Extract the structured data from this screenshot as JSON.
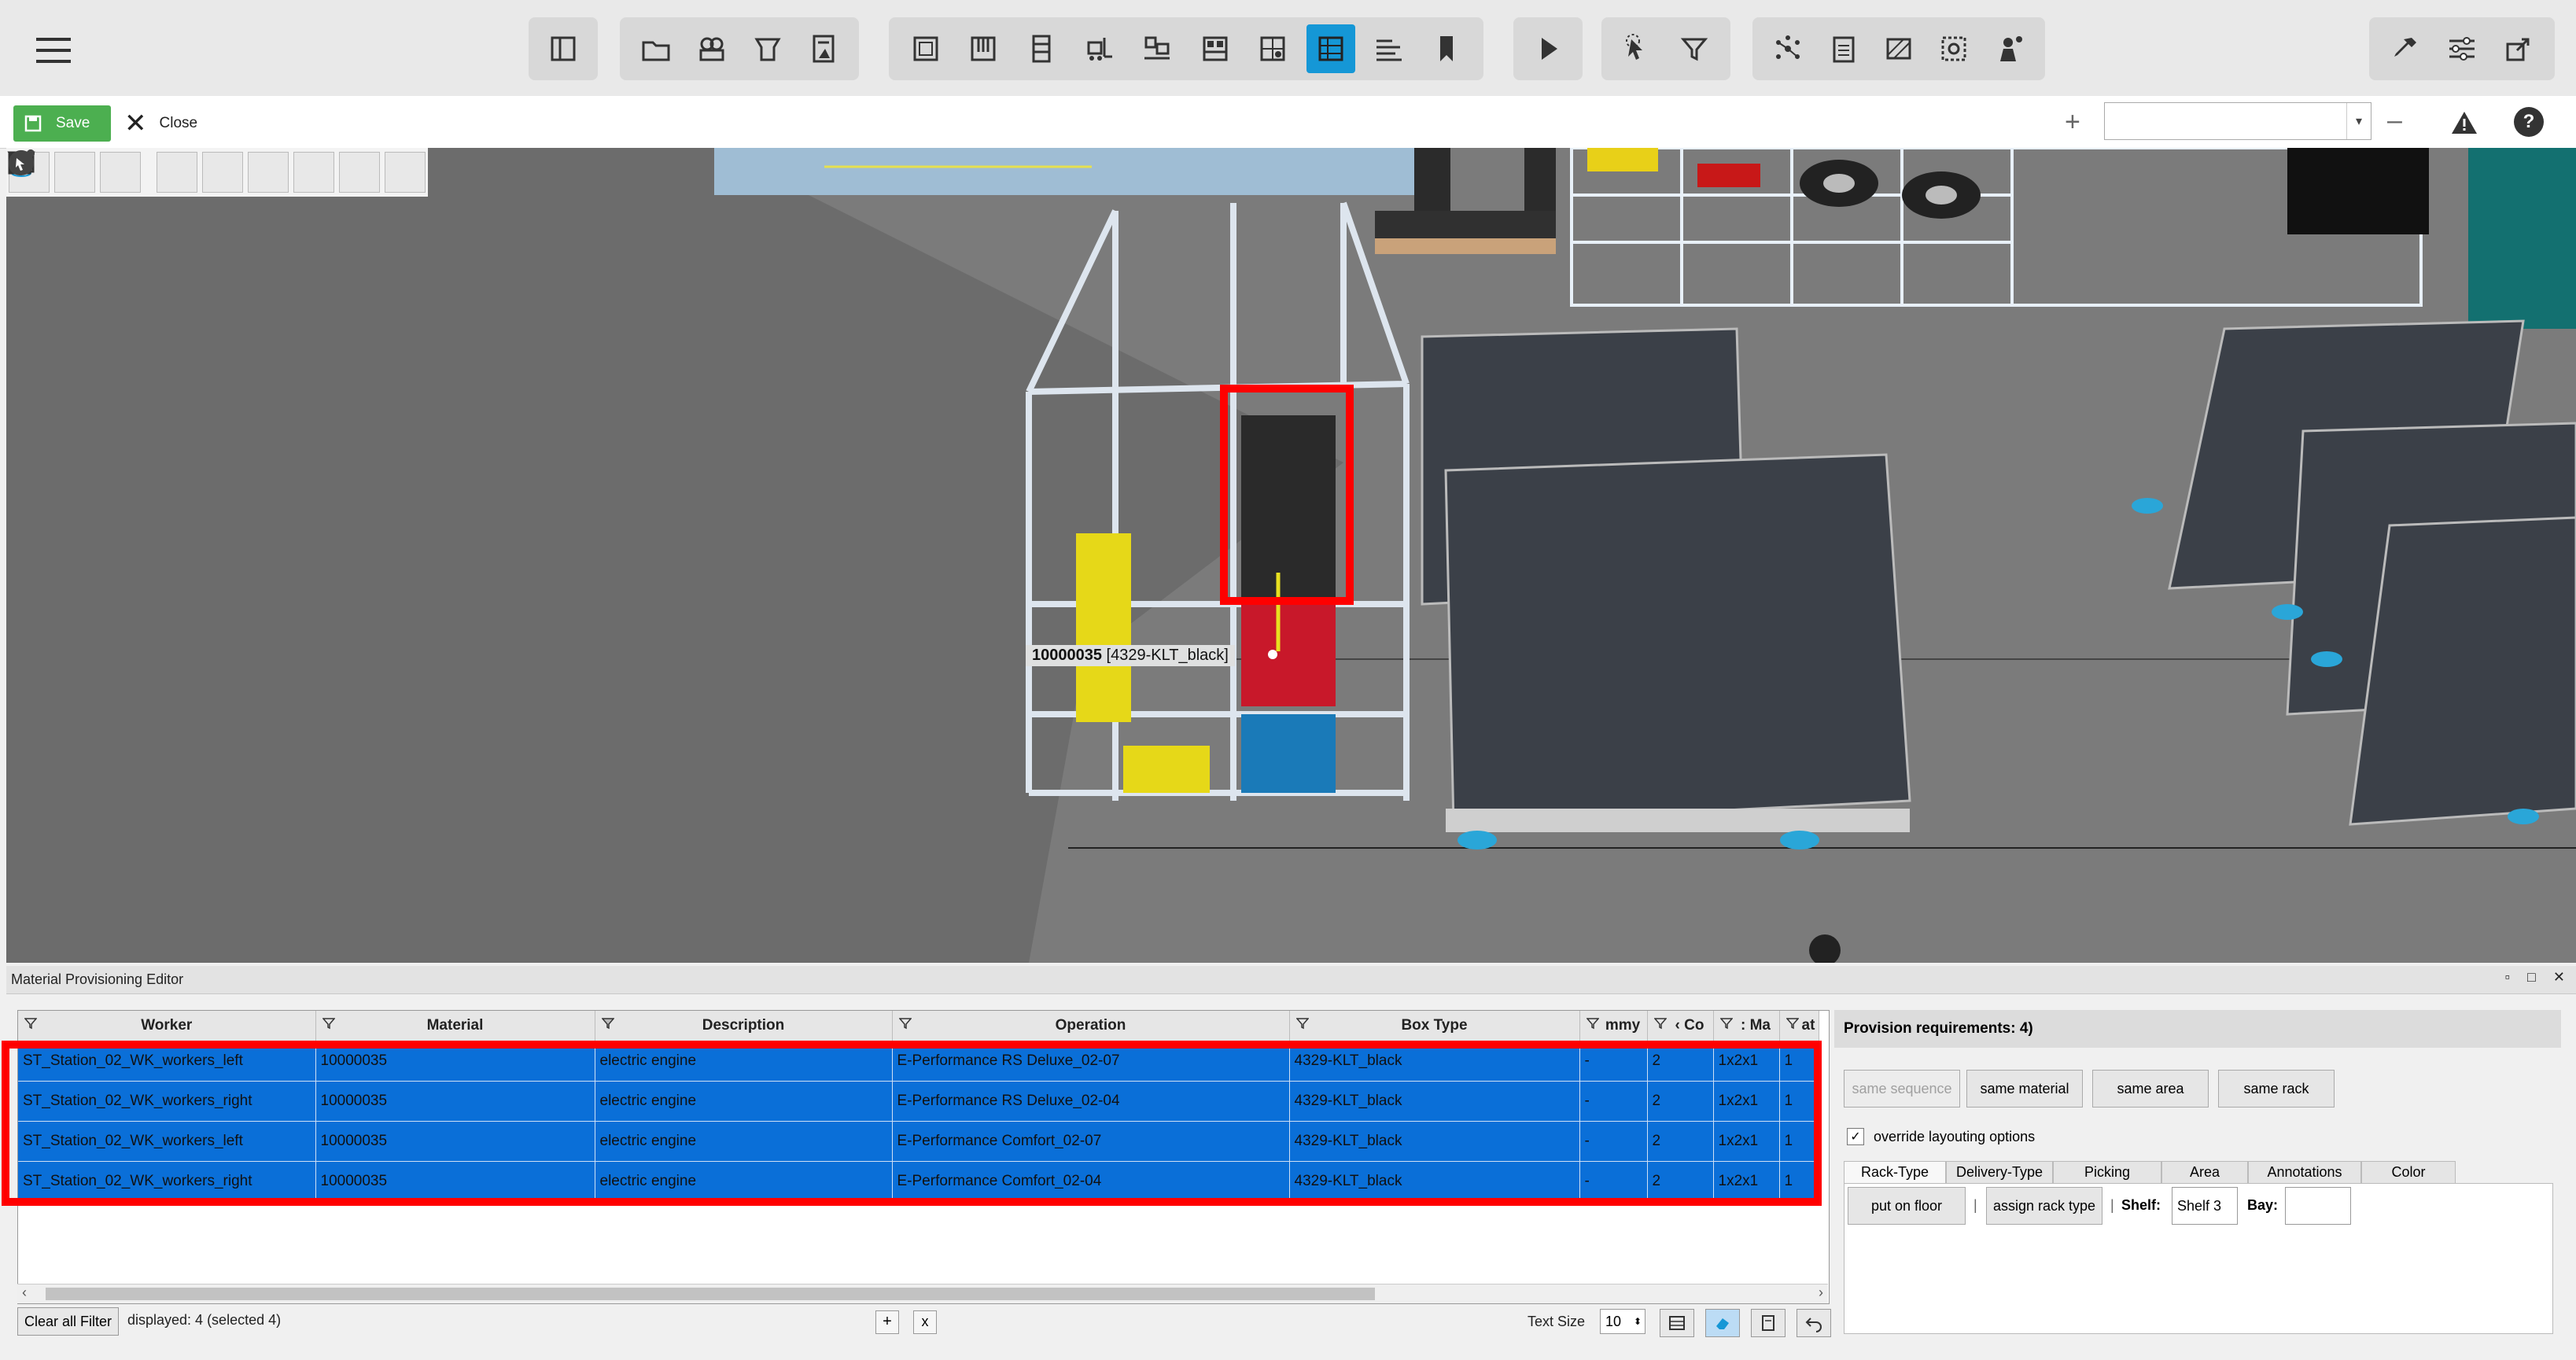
{
  "toolbar": {
    "icons": [
      "menu-icon",
      "panel-toggle-icon",
      "folder-open-icon",
      "layers-icon",
      "workstation-icon",
      "document-chart-icon",
      "layout-frame-icon",
      "rack-icon",
      "shelf-icon",
      "forklift-icon",
      "conveyor-icon",
      "storage-icon",
      "grid-layout-icon",
      "material-provisioning-icon",
      "lines-icon",
      "bookmark-icon",
      "play-icon",
      "select-cursor-icon",
      "filter-icon",
      "network-icon",
      "clipboard-icon",
      "hatch-icon",
      "measure-icon",
      "person-info-icon",
      "pipette-icon",
      "settings-sliders-icon",
      "export-icon"
    ],
    "active": "material-provisioning-icon"
  },
  "actionbar": {
    "save_label": "Save",
    "close_label": "Close",
    "view_select_value": ""
  },
  "viewport": {
    "position_label_id": "10000035",
    "position_label_box": "[4329-KLT_black]"
  },
  "panel": {
    "title": "Material Provisioning Editor"
  },
  "grid": {
    "columns": [
      "Worker",
      "Material",
      "Description",
      "Operation",
      "Box Type",
      "mmy",
      "‹ Co",
      ": Ma",
      "at"
    ],
    "rows": [
      [
        "ST_Station_02_WK_workers_left",
        "10000035",
        "electric engine",
        "E-Performance RS Deluxe_02-07",
        "4329-KLT_black",
        "-",
        "2",
        "1x2x1",
        "1"
      ],
      [
        "ST_Station_02_WK_workers_right",
        "10000035",
        "electric engine",
        "E-Performance RS Deluxe_02-04",
        "4329-KLT_black",
        "-",
        "2",
        "1x2x1",
        "1"
      ],
      [
        "ST_Station_02_WK_workers_left",
        "10000035",
        "electric engine",
        "E-Performance Comfort_02-07",
        "4329-KLT_black",
        "-",
        "2",
        "1x2x1",
        "1"
      ],
      [
        "ST_Station_02_WK_workers_right",
        "10000035",
        "electric engine",
        "E-Performance Comfort_02-04",
        "4329-KLT_black",
        "-",
        "2",
        "1x2x1",
        "1"
      ]
    ],
    "selected_color": "#0a6fd8"
  },
  "footer": {
    "clear_filter": "Clear all Filter",
    "displayed": "displayed: 4 (selected 4)",
    "add": "+",
    "remove": "x",
    "text_size_label": "Text Size",
    "text_size_value": "10"
  },
  "provision": {
    "title": "Provision requirements: 4)",
    "same_sequence": "same sequence",
    "same_material": "same material",
    "same_area": "same area",
    "same_rack": "same rack",
    "override_label": "override layouting options",
    "tabs": [
      "Rack-Type",
      "Delivery-Type",
      "Picking",
      "Area",
      "Annotations",
      "Color"
    ],
    "put_on_floor": "put on floor",
    "sep": "|",
    "assign_rack_type": "assign rack type",
    "shelf_label": "Shelf:",
    "shelf_value": "Shelf 3",
    "bay_label": "Bay:",
    "bay_value": ""
  },
  "colors": {
    "accent": "#1597d6",
    "save_green": "#4caf50",
    "highlight_red": "#ff0000"
  }
}
